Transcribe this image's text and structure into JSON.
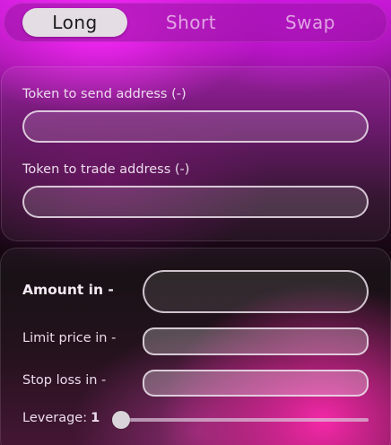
{
  "tabs": {
    "long": "Long",
    "short": "Short",
    "swap": "Swap",
    "active": "long"
  },
  "addresses": {
    "send_label": "Token to send address (-)",
    "send_value": "",
    "trade_label": "Token to trade address (-)",
    "trade_value": ""
  },
  "order": {
    "amount_label": "Amount in -",
    "amount_value": "",
    "limit_label": "Limit price in -",
    "limit_value": "",
    "stop_label": "Stop loss in -",
    "stop_value": "",
    "leverage_label": "Leverage:",
    "leverage_value": "1"
  },
  "colors": {
    "accent_magenta": "#ff28ff",
    "accent_pink": "#ff1eaa",
    "active_tab_bg": "#e4dde4"
  }
}
